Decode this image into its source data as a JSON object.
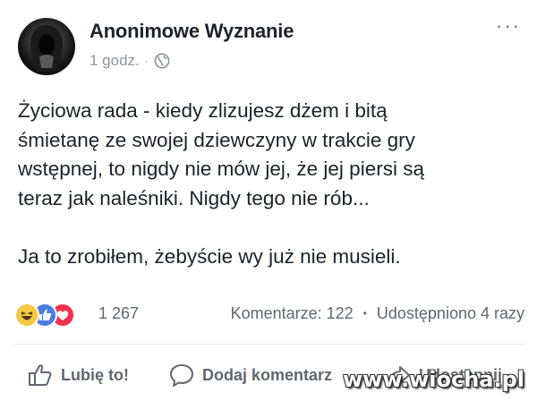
{
  "post": {
    "author": "Anonimowe Wyznanie",
    "time": "1 godz.",
    "dot": "·",
    "privacy_icon": "globe-icon",
    "more": "···",
    "text": "Życiowa rada - kiedy zlizujesz dżem i bitą\nśmietanę ze swojej dziewczyny w trakcie gry\nwstępnej, to nigdy nie mów jej, że jej piersi są\nteraz jak naleśniki. Nigdy tego nie rób...\n\nJa to zrobiłem, żebyście wy już nie musieli."
  },
  "stats": {
    "reaction_icons": [
      "haha-icon",
      "like-icon",
      "love-icon"
    ],
    "reactions_count": "1 267",
    "comments": "Komentarze: 122",
    "separator": "•",
    "shares": "Udostępniono 4 razy"
  },
  "actions": {
    "like": "Lubię to!",
    "comment": "Dodaj komentarz",
    "share": "Udostępnij"
  },
  "watermark": "www.wiocha.pl",
  "colors": {
    "like_blue": "#4a7de2",
    "love_red": "#f0334f",
    "haha_yellow": "#f7c843",
    "muted_text": "#606770"
  }
}
